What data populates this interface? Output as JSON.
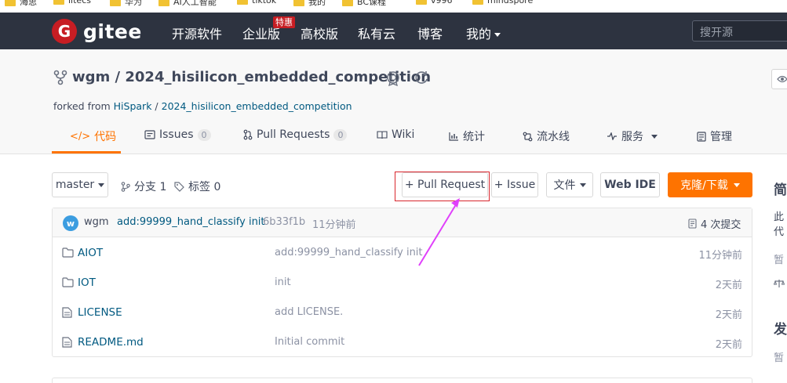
{
  "bookmarks": [
    "海思",
    "litecs",
    "华为",
    "AI人工智能",
    "tiktok",
    "我的",
    "BC课程",
    "v996",
    "mindspore"
  ],
  "navbar": {
    "brand": "gitee",
    "items": [
      "开源软件",
      "企业版",
      "高校版",
      "私有云",
      "博客",
      "我的"
    ],
    "special_badge": "特惠",
    "search_placeholder": "搜开源"
  },
  "repo": {
    "title": "wgm / 2024_hisilicon_embedded_competition",
    "forked_prefix": "forked from",
    "forked_owner": "HiSpark",
    "forked_separator": "/",
    "forked_repo": "2024_hisilicon_embedded_competition"
  },
  "tabs": [
    {
      "label": "代码"
    },
    {
      "label": "Issues",
      "count": "0"
    },
    {
      "label": "Pull Requests",
      "count": "0"
    },
    {
      "label": "Wiki"
    },
    {
      "label": "统计"
    },
    {
      "label": "流水线"
    },
    {
      "label": "服务"
    },
    {
      "label": "管理"
    }
  ],
  "toolbar": {
    "branch": "master",
    "branches": "分支 1",
    "tags": "标签 0",
    "pull_request": "+ Pull Request",
    "issue": "+ Issue",
    "file": "文件",
    "web_ide": "Web IDE",
    "clone": "克隆/下载"
  },
  "commit": {
    "avatar": "w",
    "author": "wgm",
    "message": "add:99999_hand_classify init",
    "hash": "6b33f1b",
    "time": "11分钟前",
    "count": "4 次提交"
  },
  "files": [
    {
      "name": "AIOT",
      "type": "folder",
      "message": "add:99999_hand_classify init",
      "time": "11分钟前"
    },
    {
      "name": "IOT",
      "type": "folder",
      "message": "init",
      "time": "2天前"
    },
    {
      "name": "LICENSE",
      "type": "file",
      "message": "add LICENSE.",
      "time": "2天前"
    },
    {
      "name": "README.md",
      "type": "file",
      "message": "Initial commit",
      "time": "2天前"
    }
  ],
  "sidebar": {
    "intro": "简",
    "desc_line1": "此",
    "desc_line2": "代",
    "none1": "暂",
    "release": "发",
    "none2": "暂"
  },
  "colors": {
    "accent": "#fe7300",
    "nav_bg": "#2d3340",
    "annotation": "#e040fb",
    "highlight_box": "#d9262d"
  }
}
